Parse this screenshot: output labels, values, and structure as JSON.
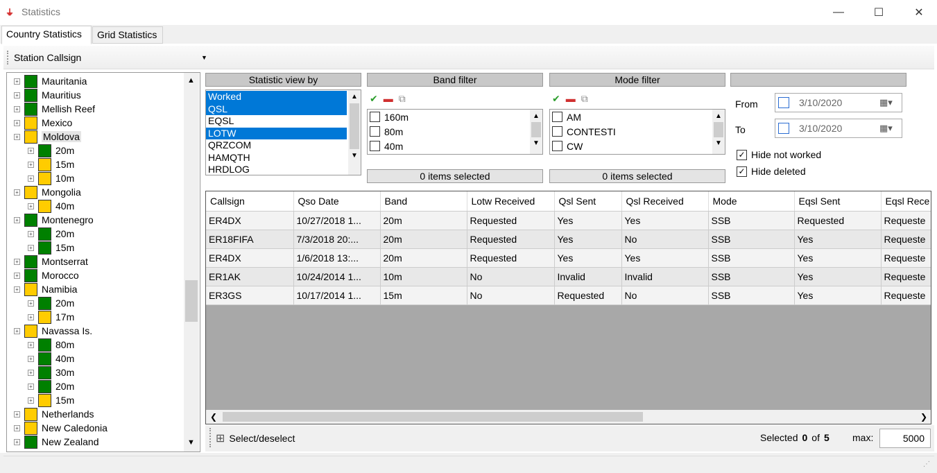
{
  "window": {
    "title": "Statistics",
    "minimize": "—",
    "maximize": "☐",
    "close": "✕"
  },
  "tabs": [
    {
      "label": "Country Statistics"
    },
    {
      "label": "Grid Statistics"
    }
  ],
  "toolbar": {
    "station_label": "Station Callsign"
  },
  "colors": {
    "green": "#008000",
    "yellow": "#ffcc00",
    "selected": "#0078d7"
  },
  "tree": [
    {
      "label": "Mauritania",
      "color": "green",
      "level": 0
    },
    {
      "label": "Mauritius",
      "color": "green",
      "level": 0
    },
    {
      "label": "Mellish Reef",
      "color": "green",
      "level": 0
    },
    {
      "label": "Mexico",
      "color": "yellow",
      "level": 0
    },
    {
      "label": "Moldova",
      "color": "yellow",
      "level": 0,
      "selected": true,
      "expanded": true
    },
    {
      "label": "20m",
      "color": "green",
      "level": 1
    },
    {
      "label": "15m",
      "color": "yellow",
      "level": 1
    },
    {
      "label": "10m",
      "color": "yellow",
      "level": 1
    },
    {
      "label": "Mongolia",
      "color": "yellow",
      "level": 0,
      "expanded": true
    },
    {
      "label": "40m",
      "color": "yellow",
      "level": 1
    },
    {
      "label": "Montenegro",
      "color": "green",
      "level": 0,
      "expanded": true
    },
    {
      "label": "20m",
      "color": "green",
      "level": 1
    },
    {
      "label": "15m",
      "color": "green",
      "level": 1
    },
    {
      "label": "Montserrat",
      "color": "green",
      "level": 0
    },
    {
      "label": "Morocco",
      "color": "green",
      "level": 0
    },
    {
      "label": "Namibia",
      "color": "yellow",
      "level": 0,
      "expanded": true
    },
    {
      "label": "20m",
      "color": "green",
      "level": 1
    },
    {
      "label": "17m",
      "color": "yellow",
      "level": 1
    },
    {
      "label": "Navassa Is.",
      "color": "yellow",
      "level": 0,
      "expanded": true
    },
    {
      "label": "80m",
      "color": "green",
      "level": 1
    },
    {
      "label": "40m",
      "color": "green",
      "level": 1
    },
    {
      "label": "30m",
      "color": "green",
      "level": 1
    },
    {
      "label": "20m",
      "color": "green",
      "level": 1
    },
    {
      "label": "15m",
      "color": "yellow",
      "level": 1
    },
    {
      "label": "Netherlands",
      "color": "yellow",
      "level": 0
    },
    {
      "label": "New Caledonia",
      "color": "yellow",
      "level": 0
    },
    {
      "label": "New Zealand",
      "color": "green",
      "level": 0
    }
  ],
  "statview": {
    "header": "Statistic view by",
    "items": [
      {
        "label": "Worked",
        "selected": true
      },
      {
        "label": "QSL",
        "selected": true
      },
      {
        "label": "EQSL",
        "selected": false
      },
      {
        "label": "LOTW",
        "selected": true
      },
      {
        "label": "QRZCOM",
        "selected": false
      },
      {
        "label": "HAMQTH",
        "selected": false
      },
      {
        "label": "HRDLOG",
        "selected": false
      }
    ]
  },
  "band_filter": {
    "header": "Band filter",
    "items": [
      "160m",
      "80m",
      "40m"
    ],
    "count": "0 items selected"
  },
  "mode_filter": {
    "header": "Mode filter",
    "items": [
      "AM",
      "CONTESTI",
      "CW"
    ],
    "count": "0 items selected"
  },
  "date_panel": {
    "from_label": "From",
    "from_value": "3/10/2020",
    "to_label": "To",
    "to_value": "3/10/2020",
    "hide_not_worked": "Hide not worked",
    "hide_deleted": "Hide deleted"
  },
  "grid": {
    "columns": [
      "Callsign",
      "Qso Date",
      "Band",
      "Lotw Received",
      "Qsl Sent",
      "Qsl Received",
      "Mode",
      "Eqsl Sent",
      "Eqsl Rece"
    ],
    "rows": [
      [
        "ER4DX",
        "10/27/2018 1...",
        "20m",
        "Requested",
        "Yes",
        "Yes",
        "SSB",
        "Requested",
        "Requeste"
      ],
      [
        "ER18FIFA",
        "7/3/2018 20:...",
        "20m",
        "Requested",
        "Yes",
        "No",
        "SSB",
        "Yes",
        "Requeste"
      ],
      [
        "ER4DX",
        "1/6/2018 13:...",
        "20m",
        "Requested",
        "Yes",
        "Yes",
        "SSB",
        "Yes",
        "Requeste"
      ],
      [
        "ER1AK",
        "10/24/2014 1...",
        "10m",
        "No",
        "Invalid",
        "Invalid",
        "SSB",
        "Yes",
        "Requeste"
      ],
      [
        "ER3GS",
        "10/17/2014 1...",
        "15m",
        "No",
        "Requested",
        "No",
        "SSB",
        "Yes",
        "Requeste"
      ]
    ]
  },
  "bottom": {
    "select_label": "Select/deselect",
    "selected_label": "Selected",
    "selected_count": "0",
    "of_label": "of",
    "total": "5",
    "max_label": "max:",
    "max_value": "5000"
  }
}
